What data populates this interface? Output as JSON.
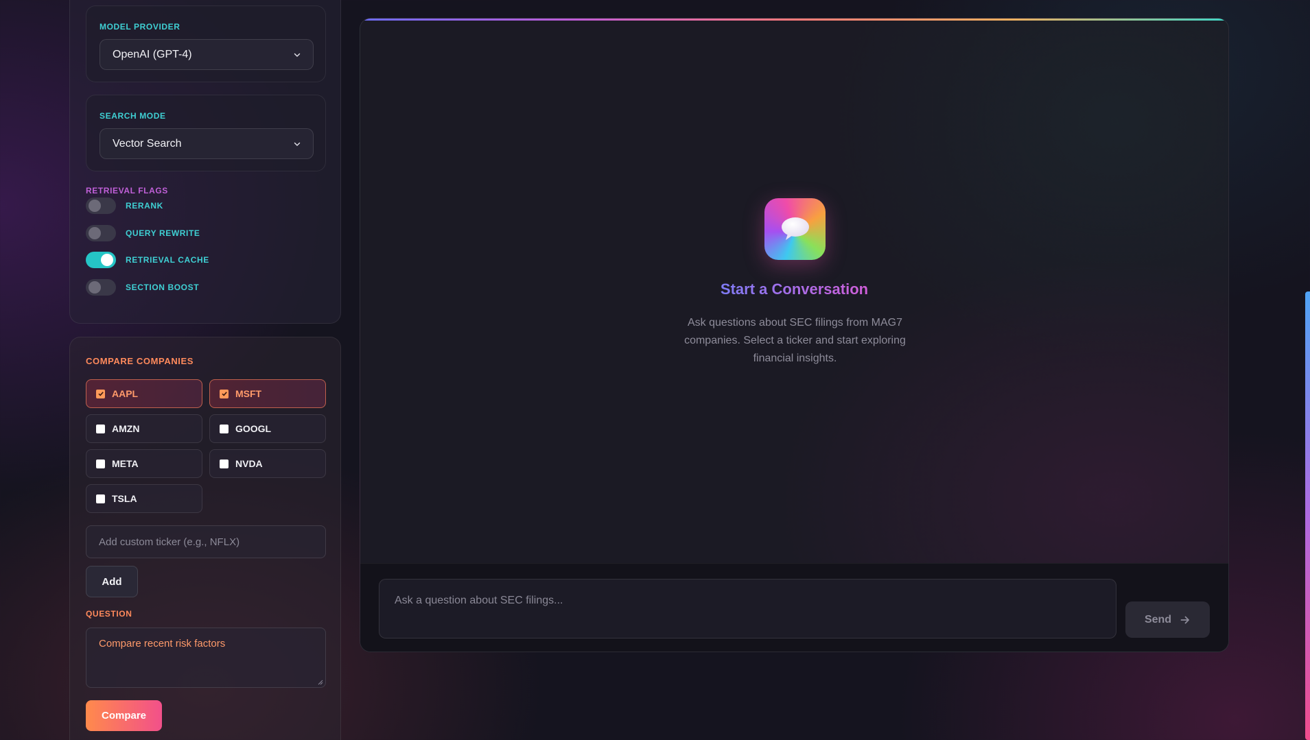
{
  "settings": {
    "model_provider": {
      "label": "MODEL PROVIDER",
      "value": "OpenAI (GPT-4)",
      "label_color": "#3fd0d4"
    },
    "search_mode": {
      "label": "SEARCH MODE",
      "value": "Vector Search",
      "label_color": "#3fd0d4"
    },
    "retrieval_flags": {
      "label": "RETRIEVAL FLAGS",
      "label_color": "#c060d8",
      "flags": [
        {
          "label": "RERANK",
          "enabled": false
        },
        {
          "label": "QUERY REWRITE",
          "enabled": false
        },
        {
          "label": "RETRIEVAL CACHE",
          "enabled": true
        },
        {
          "label": "SECTION BOOST",
          "enabled": false
        }
      ]
    }
  },
  "compare": {
    "label": "COMPARE COMPANIES",
    "label_color": "#ff8a5c",
    "tickers": [
      {
        "symbol": "AAPL",
        "checked": true
      },
      {
        "symbol": "MSFT",
        "checked": true
      },
      {
        "symbol": "AMZN",
        "checked": false
      },
      {
        "symbol": "GOOGL",
        "checked": false
      },
      {
        "symbol": "META",
        "checked": false
      },
      {
        "symbol": "NVDA",
        "checked": false
      },
      {
        "symbol": "TSLA",
        "checked": false
      }
    ],
    "custom_ticker_placeholder": "Add custom ticker (e.g., NFLX)",
    "add_label": "Add",
    "question_label": "QUESTION",
    "question_value": "Compare recent risk factors",
    "compare_label": "Compare"
  },
  "chat": {
    "empty_title": "Start a Conversation",
    "empty_description": "Ask questions about SEC filings from MAG7 companies. Select a ticker and start exploring financial insights.",
    "input_placeholder": "Ask a question about SEC filings...",
    "send_label": "Send",
    "icons": {
      "empty_state": "chat-bubble-icon",
      "send": "arrow-right-icon"
    }
  },
  "colors": {
    "accent_teal": "#25c5c6",
    "accent_orange": "#ff8a4c",
    "accent_pink": "#f2508a",
    "background": "#15141f"
  }
}
